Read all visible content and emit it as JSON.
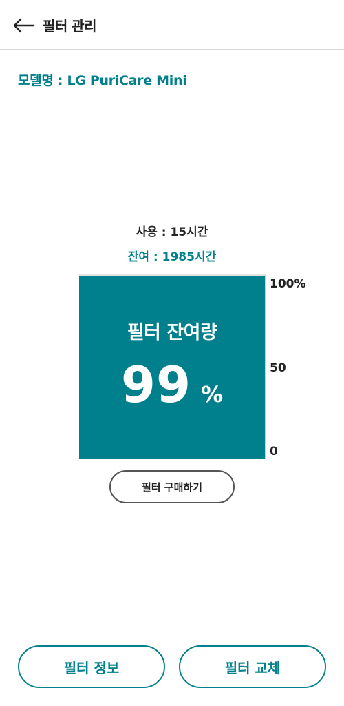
{
  "header": {
    "title": "필터 관리",
    "back_icon": "back-arrow-icon"
  },
  "model": {
    "text": "모델명 : LG PuriCare Mini"
  },
  "usage": {
    "used_text": "사용 : 15시간",
    "remaining_text": "잔여 : 1985시간"
  },
  "gauge": {
    "label": "필터 잔여량",
    "value": "99",
    "unit": "%",
    "fill_fraction": 0.99,
    "scale_top": "100%",
    "scale_mid": "50",
    "scale_bottom": "0",
    "fill_color": "#00808c",
    "track_color": "#e4e4e4"
  },
  "buttons": {
    "buy_label": "필터 구매하기",
    "info_label": "필터 정보",
    "replace_label": "필터 교체"
  },
  "colors": {
    "accent": "#00808c",
    "text": "#222222"
  }
}
